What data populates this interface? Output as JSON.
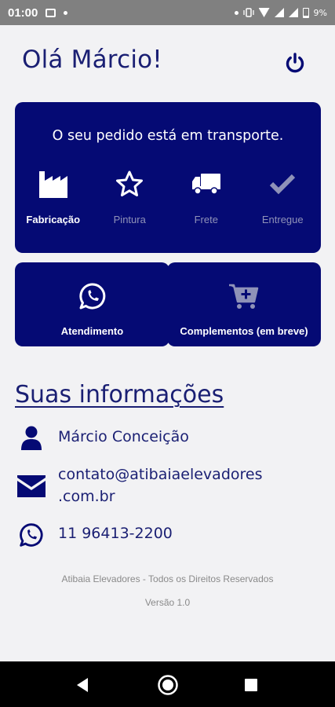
{
  "status_bar": {
    "time": "01:00",
    "battery": "9%",
    "icons": [
      "image-icon",
      "dot-icon",
      "dot-icon",
      "vibrate-icon",
      "wifi-icon",
      "signal-icon",
      "signal-icon",
      "battery-icon"
    ]
  },
  "header": {
    "greeting": "Olá Márcio!",
    "power_icon": "power-icon"
  },
  "order_status": {
    "title": "O seu pedido está em transporte.",
    "steps": [
      {
        "label": "Fabricação",
        "icon": "factory-icon",
        "active": true
      },
      {
        "label": "Pintura",
        "icon": "star-icon",
        "active": false
      },
      {
        "label": "Frete",
        "icon": "truck-icon",
        "active": false
      },
      {
        "label": "Entregue",
        "icon": "check-icon",
        "active": false
      }
    ]
  },
  "actions": [
    {
      "label": "Atendimento",
      "icon": "whatsapp-icon"
    },
    {
      "label": "Complementos (em breve)",
      "icon": "cart-plus-icon"
    }
  ],
  "info": {
    "heading": "Suas informações",
    "name": "Márcio Conceição",
    "email_line1": "contato@atibaiaelevadores",
    "email_line2": ".com.br",
    "phone": "11 96413-2200"
  },
  "footer": {
    "rights": "Atibaia Elevadores - Todos os Direitos Reservados",
    "version": "Versão 1.0"
  },
  "colors": {
    "primary": "#050a74",
    "text_primary": "#1a1f73",
    "background": "#f2f2f4",
    "inactive_label": "#8f92b8"
  }
}
